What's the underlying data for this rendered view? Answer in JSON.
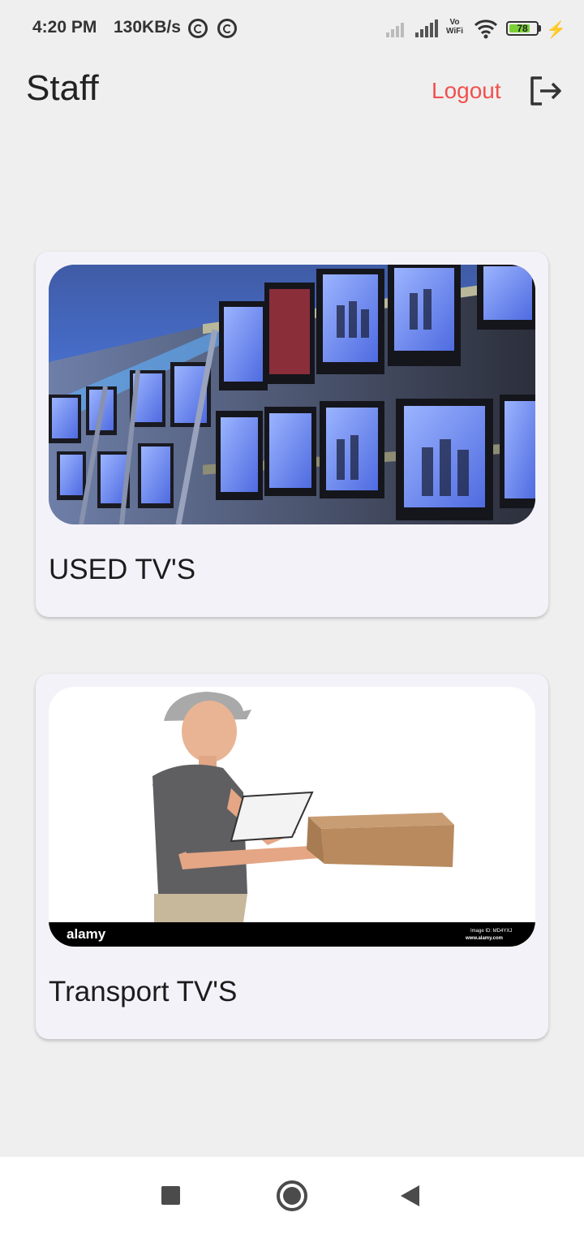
{
  "status_bar": {
    "time": "4:20 PM",
    "net_speed": "130KB/s",
    "vowifi_top": "Vo",
    "vowifi_bottom": "WiFi",
    "battery_level": 78,
    "battery_text": "78",
    "icons": [
      "sync-icon",
      "sync-icon",
      "no-signal-icon",
      "signal-icon",
      "vowifi-icon",
      "wifi-icon",
      "battery-icon",
      "charging-icon"
    ]
  },
  "app_bar": {
    "title": "Staff",
    "logout_label": "Logout",
    "logout_icon": "logout-icon",
    "logout_color": "#f0514e"
  },
  "cards": [
    {
      "label": "USED TV'S",
      "image": "tv-store-shelves-photo"
    },
    {
      "label": "Transport TV'S",
      "image": "delivery-man-with-package-photo",
      "watermark_brand": "alamy",
      "watermark_id": "Image ID: MD4YXJ",
      "watermark_url": "www.alamy.com"
    }
  ],
  "nav_bar": {
    "icons": [
      "recents-square-icon",
      "home-circle-icon",
      "back-triangle-icon"
    ]
  }
}
